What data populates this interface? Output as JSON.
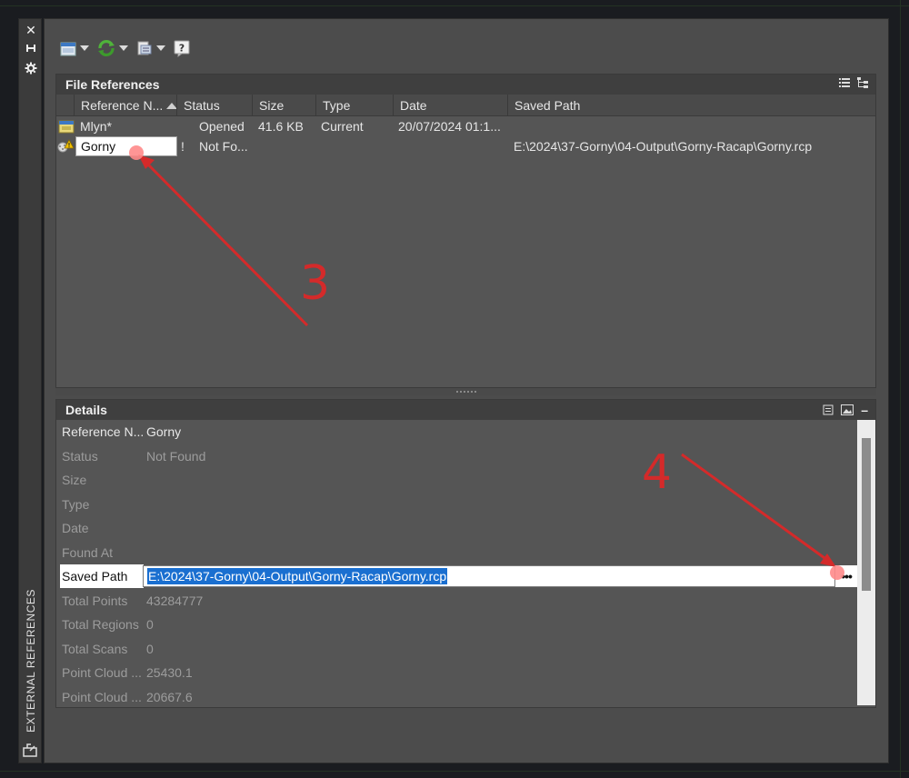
{
  "strip": {
    "title": "EXTERNAL REFERENCES",
    "buttons": [
      "close-icon",
      "auto-hide-icon",
      "properties-icon"
    ]
  },
  "toolbar": {
    "items": [
      "attach-dwg-icon",
      "refresh-icon",
      "change-path-icon",
      "help-icon"
    ],
    "help_label": "?"
  },
  "file_refs": {
    "title": "File References",
    "columns": [
      "Reference N...",
      "Status",
      "Size",
      "Type",
      "Date",
      "Saved Path"
    ],
    "rows": [
      {
        "name": "Mlyn*",
        "status": "Opened",
        "size": "41.6 KB",
        "type": "Current",
        "date": "20/07/2024 01:1...",
        "path": ""
      },
      {
        "name": "Gorny",
        "flag": "!",
        "status": "Not Fo...",
        "size": "",
        "type": "",
        "date": "",
        "path": "E:\\2024\\37-Gorny\\04-Output\\Gorny-Racap\\Gorny.rcp"
      }
    ]
  },
  "details": {
    "title": "Details",
    "collapse_label": "–",
    "rows": [
      {
        "label": "Reference N...",
        "value": "Gorny"
      },
      {
        "label": "Status",
        "value": "Not Found"
      },
      {
        "label": "Size",
        "value": ""
      },
      {
        "label": "Type",
        "value": ""
      },
      {
        "label": "Date",
        "value": ""
      },
      {
        "label": "Found At",
        "value": ""
      },
      {
        "label": "Saved Path",
        "value": "E:\\2024\\37-Gorny\\04-Output\\Gorny-Racap\\Gorny.rcp"
      },
      {
        "label": "Total Points",
        "value": "43284777"
      },
      {
        "label": "Total Regions",
        "value": "0"
      },
      {
        "label": "Total Scans",
        "value": "0"
      },
      {
        "label": "Point Cloud ...",
        "value": "25430.1"
      },
      {
        "label": "Point Cloud ...",
        "value": "20667.6"
      }
    ],
    "browse_label": "•••"
  },
  "annotations": {
    "step3": "3",
    "step4": "4",
    "color": "#d42a2a"
  }
}
